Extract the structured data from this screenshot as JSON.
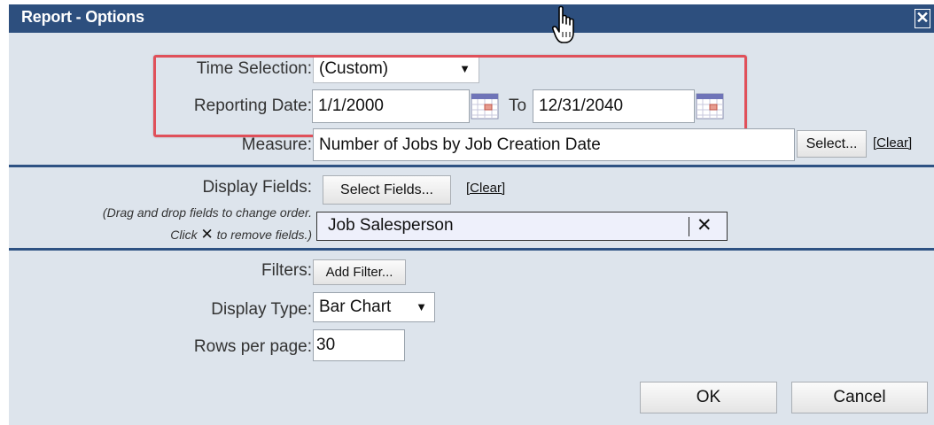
{
  "dialog": {
    "title": "Report - Options",
    "close_glyph": "✕"
  },
  "time_selection": {
    "label": "Time Selection:",
    "value": "(Custom)",
    "arrow": "▼"
  },
  "reporting_date": {
    "label": "Reporting Date:",
    "from": "1/1/2000",
    "to_label": "To",
    "to": "12/31/2040"
  },
  "measure": {
    "label": "Measure:",
    "value": "Number of Jobs by Job Creation Date",
    "select_label": "Select...",
    "clear_label": "[Clear]"
  },
  "display_fields": {
    "label": "Display Fields:",
    "hint_line1": "(Drag and drop fields to change order.",
    "hint_click": "Click",
    "hint_x": "✕",
    "hint_line2": "to remove fields.)",
    "select_label": "Select Fields...",
    "clear_label": "[Clear]",
    "fields": [
      {
        "name": "Job Salesperson",
        "remove_glyph": "✕"
      }
    ]
  },
  "filters": {
    "label": "Filters:",
    "add_label": "Add Filter..."
  },
  "display_type": {
    "label": "Display Type:",
    "value": "Bar Chart",
    "arrow": "▼"
  },
  "rows_per_page": {
    "label": "Rows per page:",
    "value": "30"
  },
  "actions": {
    "ok": "OK",
    "cancel": "Cancel"
  },
  "colors": {
    "titlebar": "#2d4f7e",
    "background": "#dde4ec",
    "highlight": "#e0505a",
    "field_bg": "#eef0fb"
  },
  "icons": [
    "close-icon",
    "calendar-icon",
    "remove-icon",
    "dropdown-arrow-icon",
    "hand-cursor-icon"
  ]
}
